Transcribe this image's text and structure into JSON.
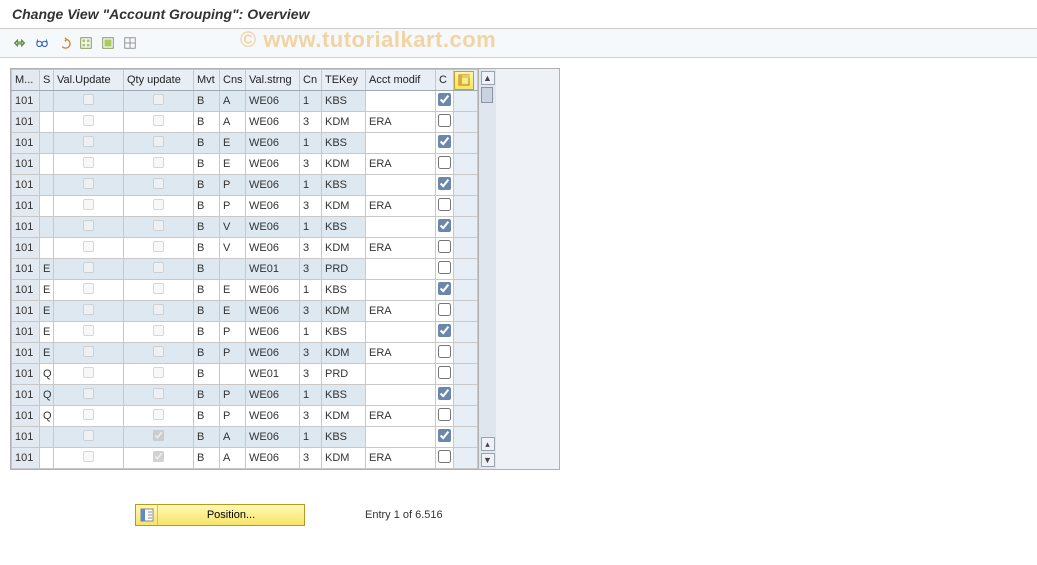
{
  "title": "Change View \"Account Grouping\": Overview",
  "watermark": "© www.tutorialkart.com",
  "toolbar": {
    "btn1": "expand-icon",
    "btn2": "glasses-icon",
    "btn3": "undo-icon",
    "btn4": "select-all-icon",
    "btn5": "select-grid-icon",
    "btn6": "deselect-icon"
  },
  "columns": {
    "m": "M...",
    "s": "S",
    "val_update": "Val.Update",
    "qty_update": "Qty update",
    "mvt": "Mvt",
    "cns": "Cns",
    "val_strng": "Val.strng",
    "cn": "Cn",
    "tekey": "TEKey",
    "acct_modif": "Acct modif",
    "c": "C"
  },
  "rows": [
    {
      "m": "101",
      "s": "",
      "vu": false,
      "qu": false,
      "mvt": "B",
      "cns": "A",
      "vstr": "WE06",
      "cn": "1",
      "tek": "KBS",
      "am": "",
      "c": true
    },
    {
      "m": "101",
      "s": "",
      "vu": false,
      "qu": false,
      "mvt": "B",
      "cns": "A",
      "vstr": "WE06",
      "cn": "3",
      "tek": "KDM",
      "am": "ERA",
      "c": false
    },
    {
      "m": "101",
      "s": "",
      "vu": false,
      "qu": false,
      "mvt": "B",
      "cns": "E",
      "vstr": "WE06",
      "cn": "1",
      "tek": "KBS",
      "am": "",
      "c": true
    },
    {
      "m": "101",
      "s": "",
      "vu": false,
      "qu": false,
      "mvt": "B",
      "cns": "E",
      "vstr": "WE06",
      "cn": "3",
      "tek": "KDM",
      "am": "ERA",
      "c": false
    },
    {
      "m": "101",
      "s": "",
      "vu": false,
      "qu": false,
      "mvt": "B",
      "cns": "P",
      "vstr": "WE06",
      "cn": "1",
      "tek": "KBS",
      "am": "",
      "c": true
    },
    {
      "m": "101",
      "s": "",
      "vu": false,
      "qu": false,
      "mvt": "B",
      "cns": "P",
      "vstr": "WE06",
      "cn": "3",
      "tek": "KDM",
      "am": "ERA",
      "c": false
    },
    {
      "m": "101",
      "s": "",
      "vu": false,
      "qu": false,
      "mvt": "B",
      "cns": "V",
      "vstr": "WE06",
      "cn": "1",
      "tek": "KBS",
      "am": "",
      "c": true
    },
    {
      "m": "101",
      "s": "",
      "vu": false,
      "qu": false,
      "mvt": "B",
      "cns": "V",
      "vstr": "WE06",
      "cn": "3",
      "tek": "KDM",
      "am": "ERA",
      "c": false
    },
    {
      "m": "101",
      "s": "E",
      "vu": false,
      "qu": false,
      "mvt": "B",
      "cns": "",
      "vstr": "WE01",
      "cn": "3",
      "tek": "PRD",
      "am": "",
      "c": false
    },
    {
      "m": "101",
      "s": "E",
      "vu": false,
      "qu": false,
      "mvt": "B",
      "cns": "E",
      "vstr": "WE06",
      "cn": "1",
      "tek": "KBS",
      "am": "",
      "c": true
    },
    {
      "m": "101",
      "s": "E",
      "vu": false,
      "qu": false,
      "mvt": "B",
      "cns": "E",
      "vstr": "WE06",
      "cn": "3",
      "tek": "KDM",
      "am": "ERA",
      "c": false
    },
    {
      "m": "101",
      "s": "E",
      "vu": false,
      "qu": false,
      "mvt": "B",
      "cns": "P",
      "vstr": "WE06",
      "cn": "1",
      "tek": "KBS",
      "am": "",
      "c": true
    },
    {
      "m": "101",
      "s": "E",
      "vu": false,
      "qu": false,
      "mvt": "B",
      "cns": "P",
      "vstr": "WE06",
      "cn": "3",
      "tek": "KDM",
      "am": "ERA",
      "c": false
    },
    {
      "m": "101",
      "s": "Q",
      "vu": false,
      "qu": false,
      "mvt": "B",
      "cns": "",
      "vstr": "WE01",
      "cn": "3",
      "tek": "PRD",
      "am": "",
      "c": false
    },
    {
      "m": "101",
      "s": "Q",
      "vu": false,
      "qu": false,
      "mvt": "B",
      "cns": "P",
      "vstr": "WE06",
      "cn": "1",
      "tek": "KBS",
      "am": "",
      "c": true
    },
    {
      "m": "101",
      "s": "Q",
      "vu": false,
      "qu": false,
      "mvt": "B",
      "cns": "P",
      "vstr": "WE06",
      "cn": "3",
      "tek": "KDM",
      "am": "ERA",
      "c": false
    },
    {
      "m": "101",
      "s": "",
      "vu": false,
      "qu": true,
      "mvt": "B",
      "cns": "A",
      "vstr": "WE06",
      "cn": "1",
      "tek": "KBS",
      "am": "",
      "c": true
    },
    {
      "m": "101",
      "s": "",
      "vu": false,
      "qu": true,
      "mvt": "B",
      "cns": "A",
      "vstr": "WE06",
      "cn": "3",
      "tek": "KDM",
      "am": "ERA",
      "c": false
    }
  ],
  "footer": {
    "position_label": "Position...",
    "entry_text": "Entry 1 of 6.516"
  }
}
